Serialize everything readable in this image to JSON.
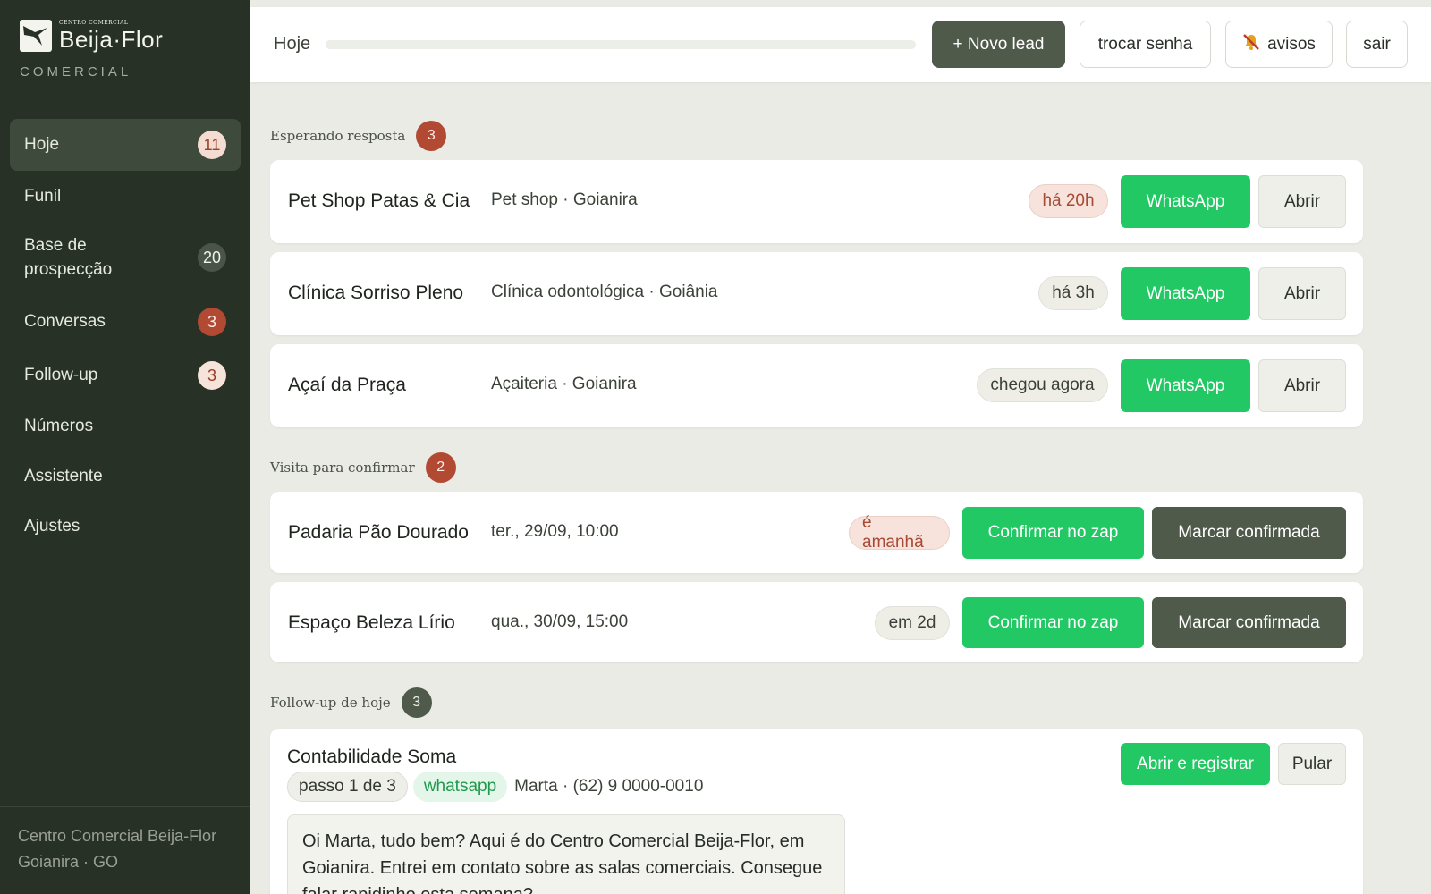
{
  "brand": {
    "small": "CENTRO COMERCIAL",
    "name": "Beija·Flor",
    "sub": "COMERCIAL"
  },
  "nav": {
    "items": [
      {
        "label": "Hoje",
        "badge": "11"
      },
      {
        "label": "Funil",
        "badge": ""
      },
      {
        "label": "Base de prospecção",
        "badge": "20"
      },
      {
        "label": "Conversas",
        "badge": "3"
      },
      {
        "label": "Follow-up",
        "badge": "3"
      },
      {
        "label": "Números",
        "badge": ""
      },
      {
        "label": "Assistente",
        "badge": ""
      },
      {
        "label": "Ajustes",
        "badge": ""
      }
    ]
  },
  "footer": {
    "line1": "Centro Comercial Beija-Flor",
    "line2": "Goianira · GO"
  },
  "topbar": {
    "title": "Hoje",
    "new_lead": "+ Novo lead",
    "change_password": "trocar senha",
    "notices": "avisos",
    "notices_icon": "bell-muted-icon",
    "logout": "sair"
  },
  "sections": {
    "waiting": {
      "title": "Esperando resposta",
      "count": "3",
      "rows": [
        {
          "name": "Pet Shop Patas & Cia",
          "meta": "Pet shop · Goianira",
          "time": "há 20h",
          "whatsapp": "WhatsApp",
          "open": "Abrir"
        },
        {
          "name": "Clínica Sorriso Pleno",
          "meta": "Clínica odontológica · Goiânia",
          "time": "há 3h",
          "whatsapp": "WhatsApp",
          "open": "Abrir"
        },
        {
          "name": "Açaí da Praça",
          "meta": "Açaiteria · Goianira",
          "time": "chegou agora",
          "whatsapp": "WhatsApp",
          "open": "Abrir"
        }
      ]
    },
    "visits": {
      "title": "Visita para confirmar",
      "count": "2",
      "rows": [
        {
          "name": "Padaria Pão Dourado",
          "meta": "ter., 29/09, 10:00",
          "when": "é amanhã",
          "confirm_zap": "Confirmar no zap",
          "mark": "Marcar confirmada"
        },
        {
          "name": "Espaço Beleza Lírio",
          "meta": "qua., 30/09, 15:00",
          "when": "em 2d",
          "confirm_zap": "Confirmar no zap",
          "mark": "Marcar confirmada"
        }
      ]
    },
    "followup": {
      "title": "Follow-up de hoje",
      "count": "3",
      "card": {
        "name": "Contabilidade Soma",
        "step": "passo 1 de 3",
        "channel": "whatsapp",
        "contact": "Marta · (62) 9 0000-0010",
        "message": "Oi Marta, tudo bem? Aqui é do Centro Comercial Beija-Flor, em Goianira. Entrei em contato sobre as salas comerciais. Consegue falar rapidinho esta semana?",
        "open_register": "Abrir e registrar",
        "skip": "Pular"
      }
    }
  },
  "colors": {
    "sidebar": "#283126",
    "accent_green": "#22c863",
    "primary_dark": "#4f5a4b",
    "badge_red": "#b24a33"
  }
}
